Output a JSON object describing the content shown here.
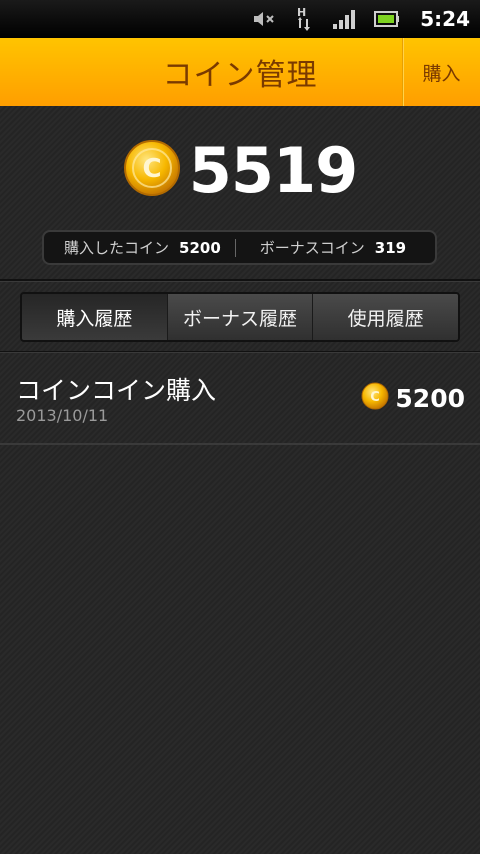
{
  "status_bar": {
    "time": "5:24",
    "icons": [
      "mute-icon",
      "hspa-data-icon",
      "signal-icon",
      "battery-icon"
    ]
  },
  "header": {
    "title": "コイン管理",
    "buy_label": "購入"
  },
  "balance": {
    "amount": "5519",
    "purchased_label": "購入したコイン",
    "purchased_value": "5200",
    "bonus_label": "ボーナスコイン",
    "bonus_value": "319"
  },
  "tabs": [
    {
      "label": "購入履歴",
      "active": true
    },
    {
      "label": "ボーナス履歴",
      "active": false
    },
    {
      "label": "使用履歴",
      "active": false
    }
  ],
  "history": [
    {
      "title": "コインコイン購入",
      "date": "2013/10/11",
      "amount": "5200"
    }
  ],
  "colors": {
    "header_top": "#ffc400",
    "header_bottom": "#ff9e00",
    "header_text": "#7a3a00",
    "coin": "#f5b800",
    "background": "#262626"
  }
}
